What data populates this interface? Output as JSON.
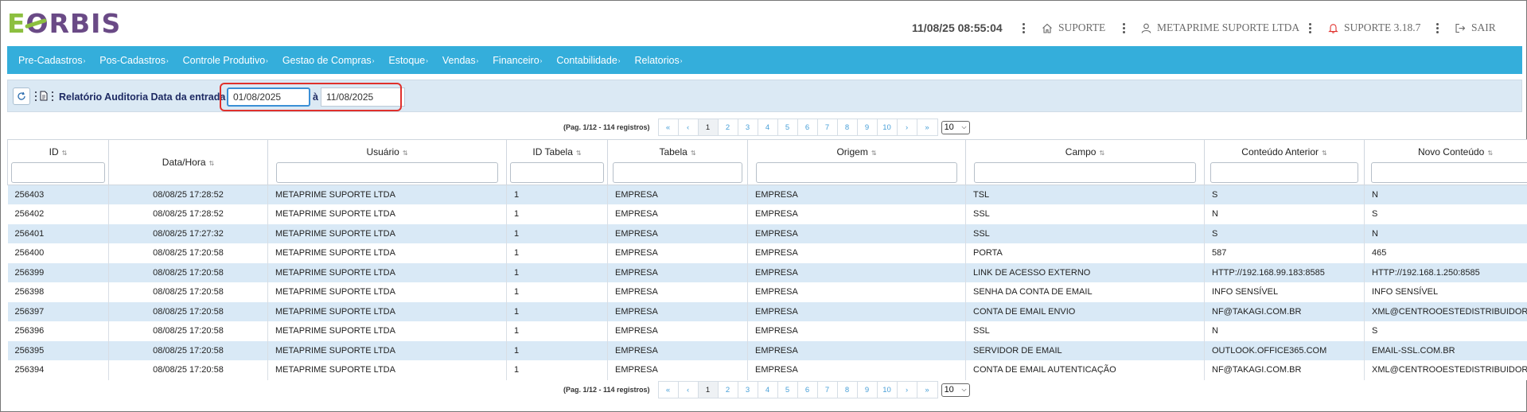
{
  "header": {
    "logo_e": "E",
    "logo_o": "O",
    "logo_rest": "RBIS",
    "clock": "11/08/25 08:55:04",
    "support_label": "SUPORTE",
    "company_label": "METAPRIME SUPORTE LTDA",
    "version_label": "SUPORTE 3.18.7",
    "logout_label": "SAIR",
    "accent_color": "#34aedb"
  },
  "menu": [
    {
      "label": "Pre-Cadastros"
    },
    {
      "label": "Pos-Cadastros"
    },
    {
      "label": "Controle Produtivo"
    },
    {
      "label": "Gestao de Compras"
    },
    {
      "label": "Estoque"
    },
    {
      "label": "Vendas"
    },
    {
      "label": "Financeiro"
    },
    {
      "label": "Contabilidade"
    },
    {
      "label": "Relatorios"
    }
  ],
  "filter": {
    "title": "Relatório Auditoria Data da entrada de",
    "date_from": "01/08/2025",
    "separator": "à",
    "date_to": "11/08/2025"
  },
  "pagination": {
    "info": "(Pag. 1/12 - 114 registros)",
    "first": "«",
    "prev": "‹",
    "pages": [
      "1",
      "2",
      "3",
      "4",
      "5",
      "6",
      "7",
      "8",
      "9",
      "10"
    ],
    "next": "›",
    "last": "»",
    "page_size": "10",
    "current_page": 1
  },
  "table": {
    "columns": [
      "ID",
      "Data/Hora",
      "Usuário",
      "ID Tabela",
      "Tabela",
      "Origem",
      "Campo",
      "Conteúdo Anterior",
      "Novo Conteúdo"
    ],
    "rows": [
      [
        "256403",
        "08/08/25 17:28:52",
        "METAPRIME SUPORTE LTDA",
        "1",
        "EMPRESA",
        "EMPRESA",
        "TSL",
        "S",
        "N"
      ],
      [
        "256402",
        "08/08/25 17:28:52",
        "METAPRIME SUPORTE LTDA",
        "1",
        "EMPRESA",
        "EMPRESA",
        "SSL",
        "N",
        "S"
      ],
      [
        "256401",
        "08/08/25 17:27:32",
        "METAPRIME SUPORTE LTDA",
        "1",
        "EMPRESA",
        "EMPRESA",
        "SSL",
        "S",
        "N"
      ],
      [
        "256400",
        "08/08/25 17:20:58",
        "METAPRIME SUPORTE LTDA",
        "1",
        "EMPRESA",
        "EMPRESA",
        "PORTA",
        "587",
        "465"
      ],
      [
        "256399",
        "08/08/25 17:20:58",
        "METAPRIME SUPORTE LTDA",
        "1",
        "EMPRESA",
        "EMPRESA",
        "LINK DE ACESSO EXTERNO",
        "HTTP://192.168.99.183:8585",
        "HTTP://192.168.1.250:8585"
      ],
      [
        "256398",
        "08/08/25 17:20:58",
        "METAPRIME SUPORTE LTDA",
        "1",
        "EMPRESA",
        "EMPRESA",
        "SENHA DA CONTA DE EMAIL",
        "INFO SENSÍVEL",
        "INFO SENSÍVEL"
      ],
      [
        "256397",
        "08/08/25 17:20:58",
        "METAPRIME SUPORTE LTDA",
        "1",
        "EMPRESA",
        "EMPRESA",
        "CONTA DE EMAIL ENVIO",
        "NF@TAKAGI.COM.BR",
        "XML@CENTROOESTEDISTRIBUIDORA.COM.BR"
      ],
      [
        "256396",
        "08/08/25 17:20:58",
        "METAPRIME SUPORTE LTDA",
        "1",
        "EMPRESA",
        "EMPRESA",
        "SSL",
        "N",
        "S"
      ],
      [
        "256395",
        "08/08/25 17:20:58",
        "METAPRIME SUPORTE LTDA",
        "1",
        "EMPRESA",
        "EMPRESA",
        "SERVIDOR DE EMAIL",
        "OUTLOOK.OFFICE365.COM",
        "EMAIL-SSL.COM.BR"
      ],
      [
        "256394",
        "08/08/25 17:20:58",
        "METAPRIME SUPORTE LTDA",
        "1",
        "EMPRESA",
        "EMPRESA",
        "CONTA DE EMAIL AUTENTICAÇÃO",
        "NF@TAKAGI.COM.BR",
        "XML@CENTROOESTEDISTRIBUIDORA.COM.BR"
      ]
    ]
  }
}
